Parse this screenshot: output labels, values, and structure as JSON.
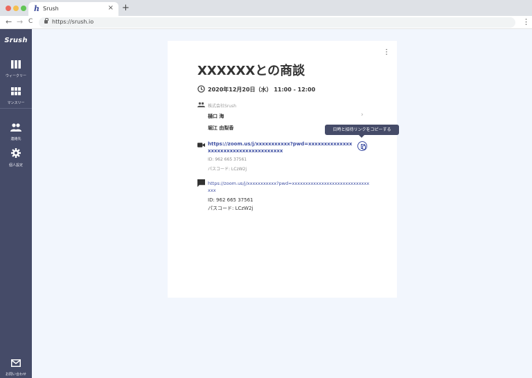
{
  "browser": {
    "tab_title": "Srush",
    "tab_favicon": "h",
    "tab_close": "×",
    "new_tab": "+",
    "back": "←",
    "forward": "→",
    "reload": "C",
    "url": "https://srush.io",
    "menu": "⋮"
  },
  "sidebar": {
    "logo": "Srush",
    "items": [
      {
        "label": "ウィークリー",
        "icon": "weekly-icon"
      },
      {
        "label": "マンスリー",
        "icon": "monthly-icon"
      },
      {
        "label": "連絡先",
        "icon": "contacts-icon"
      },
      {
        "label": "個人設定",
        "icon": "settings-icon"
      }
    ],
    "footer": {
      "label": "お問い合わせ",
      "icon": "mail-icon"
    }
  },
  "event": {
    "menu": "⋮",
    "title": "XXXXXXとの商談",
    "datetime": "2020年12月20日（水） 11:00 - 12:00",
    "company": "株式会社Srush",
    "members": [
      "樋口 海",
      "堀江 由梨香"
    ],
    "member_chevron": "›",
    "tooltip": "日時と招待リンクをコピーする",
    "zoom_link": "https://zoom.us/j/xxxxxxxxxxx?pwd=xxxxxxxxxxxxxxxxxxxxxxxxxxxxxxxxxxxxxx",
    "zoom_id": "ID: 962 665 37561",
    "zoom_passcode": "パスコード: LCzW2j",
    "note_link": "https://zoom.us/j/xxxxxxxxxxx?pwd=xxxxxxxxxxxxxxxxxxxxxxxxxxxxxxxx",
    "note_id": "ID: 962 665 37561",
    "note_passcode": "パスコード: LCzW2j"
  },
  "colors": {
    "sidebar": "#454b68",
    "accent": "#3e4fa3",
    "background": "#f2f6fd"
  }
}
